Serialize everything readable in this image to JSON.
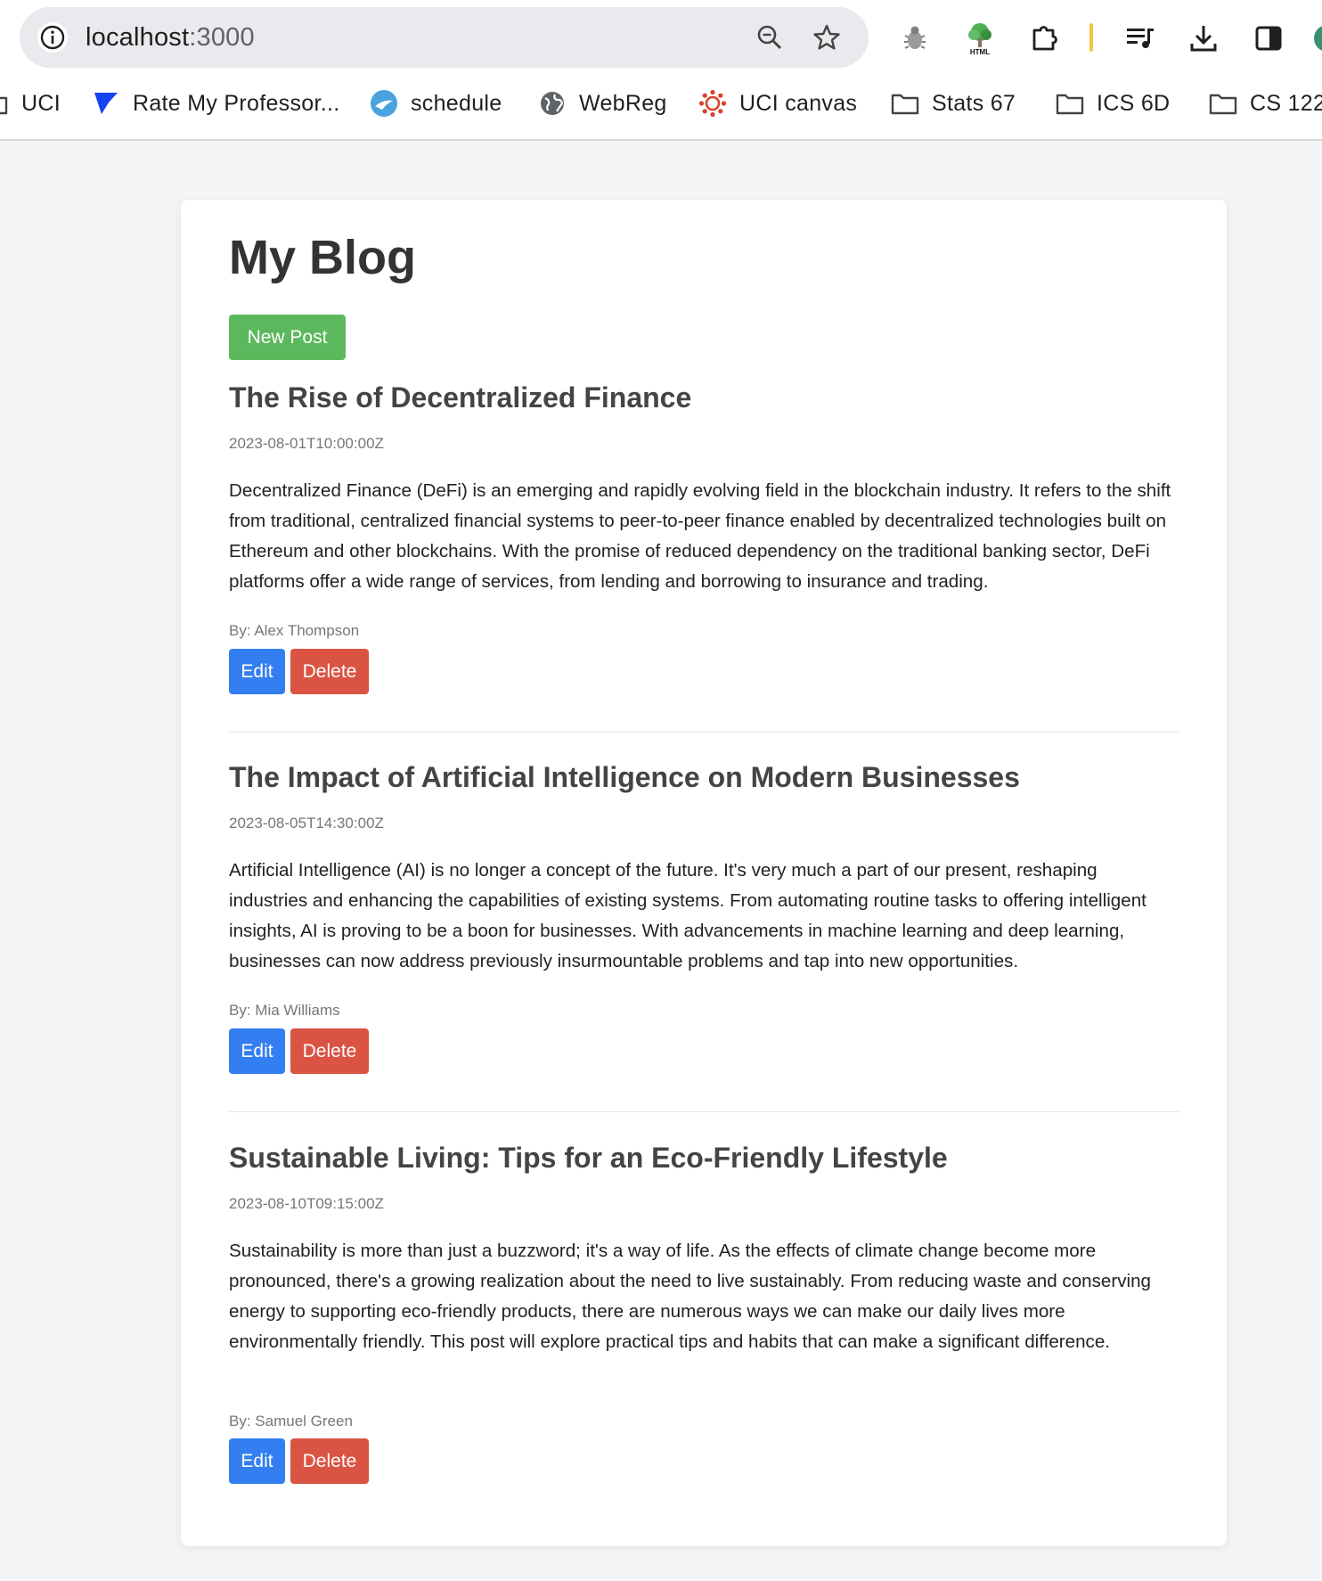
{
  "browser": {
    "url_host": "localhost",
    "url_port": ":3000",
    "bookmarks": [
      {
        "label": "UCI",
        "icon": "folder-icon"
      },
      {
        "label": "Rate My Professor...",
        "icon": "rmp-icon"
      },
      {
        "label": "schedule",
        "icon": "schedule-icon"
      },
      {
        "label": "WebReg",
        "icon": "globe-icon"
      },
      {
        "label": "UCI canvas",
        "icon": "canvas-icon"
      },
      {
        "label": "Stats 67",
        "icon": "folder-icon"
      },
      {
        "label": "ICS 6D",
        "icon": "folder-icon"
      },
      {
        "label": "CS 122",
        "icon": "folder-icon"
      }
    ],
    "toolbar_icons": [
      "info-icon",
      "zoom-icon",
      "star-icon",
      "bug-extension-icon",
      "html-tree-extension-icon",
      "extensions-puzzle-icon",
      "media-queue-icon",
      "download-icon",
      "side-panel-icon",
      "profile-avatar-icon"
    ]
  },
  "blog": {
    "title": "My Blog",
    "new_post_label": "New Post",
    "edit_label": "Edit",
    "delete_label": "Delete",
    "posts": [
      {
        "title": "The Rise of Decentralized Finance",
        "date": "2023-08-01T10:00:00Z",
        "body": "Decentralized Finance (DeFi) is an emerging and rapidly evolving field in the blockchain industry. It refers to the shift from traditional, centralized financial systems to peer-to-peer finance enabled by decentralized technologies built on Ethereum and other blockchains. With the promise of reduced dependency on the traditional banking sector, DeFi platforms offer a wide range of services, from lending and borrowing to insurance and trading.",
        "author": "By: Alex Thompson"
      },
      {
        "title": "The Impact of Artificial Intelligence on Modern Businesses",
        "date": "2023-08-05T14:30:00Z",
        "body": "Artificial Intelligence (AI) is no longer a concept of the future. It's very much a part of our present, reshaping industries and enhancing the capabilities of existing systems. From automating routine tasks to offering intelligent insights, AI is proving to be a boon for businesses. With advancements in machine learning and deep learning, businesses can now address previously insurmountable problems and tap into new opportunities.",
        "author": "By: Mia Williams"
      },
      {
        "title": "Sustainable Living: Tips for an Eco-Friendly Lifestyle",
        "date": "2023-08-10T09:15:00Z",
        "body": "Sustainability is more than just a buzzword; it's a way of life. As the effects of climate change become more pronounced, there's a growing realization about the need to live sustainably. From reducing waste and conserving energy to supporting eco-friendly products, there are numerous ways we can make our daily lives more environmentally friendly. This post will explore practical tips and habits that can make a significant difference.",
        "author": "By: Samuel Green"
      }
    ]
  },
  "colors": {
    "new_post_button": "#5cb85c",
    "edit_button": "#337ef0",
    "delete_button": "#db5443",
    "page_background": "#f4f5f7"
  }
}
